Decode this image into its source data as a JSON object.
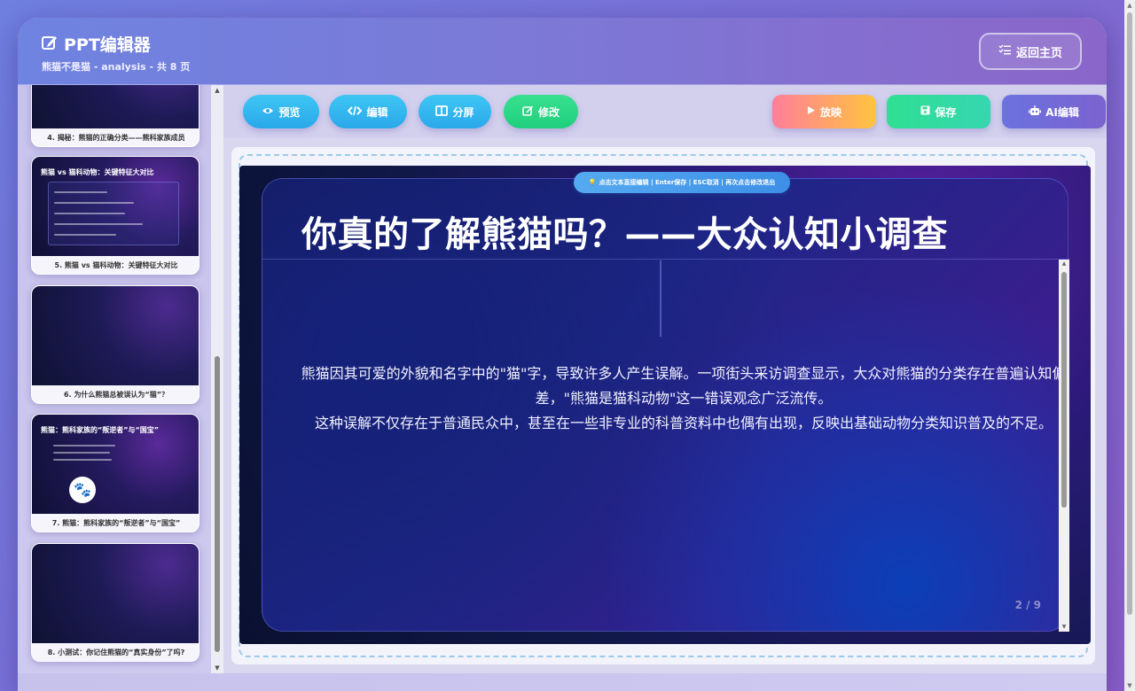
{
  "header": {
    "title": "PPT编辑器",
    "subtitle": "熊猫不是猫 - analysis - 共 8 页",
    "home_label": "返回主页"
  },
  "sidebar": {
    "slides": [
      {
        "caption": "4. 揭秘：熊猫的正确分类——熊科家族成员",
        "mini_title": ""
      },
      {
        "caption": "5. 熊猫 vs 猫科动物：关键特征大对比",
        "mini_title": "熊猫 vs 猫科动物：关键特征大对比"
      },
      {
        "caption": "6. 为什么熊猫总被误认为“猫”？",
        "mini_title": ""
      },
      {
        "caption": "7. 熊猫：熊科家族的“叛逆者”与“国宝”",
        "mini_title": "熊猫：熊科家族的“叛逆者”与“国宝”"
      },
      {
        "caption": "8. 小测试：你记住熊猫的“真实身份”了吗?",
        "mini_title": ""
      }
    ]
  },
  "toolbar": {
    "preview": "预览",
    "edit": "编辑",
    "split": "分屏",
    "modify": "修改",
    "play": "放映",
    "save": "保存",
    "ai_edit": "AI编辑"
  },
  "editor": {
    "hint": "点击文本直接编辑 | Enter保存 | ESC取消 | 再次点击修改退出",
    "slide_title": "你真的了解熊猫吗？——大众认知小调查",
    "body_lines": [
      "熊猫因其可爱的外貌和名字中的\"猫\"字，导致许多人产生误解。一项街头采访调查显示，大众对熊猫的分类存在普遍认知偏差，\"熊猫是猫科动物\"这一错误观念广泛流传。",
      "这种误解不仅存在于普通民众中，甚至在一些非专业的科普资料中也偶有出现，反映出基础动物分类知识普及的不足。"
    ],
    "page_number": "2 / 9"
  },
  "colors": {
    "accent_cyan": "#2aa8ea",
    "accent_green": "#1fcf7d",
    "slide_bg": "#101848"
  }
}
